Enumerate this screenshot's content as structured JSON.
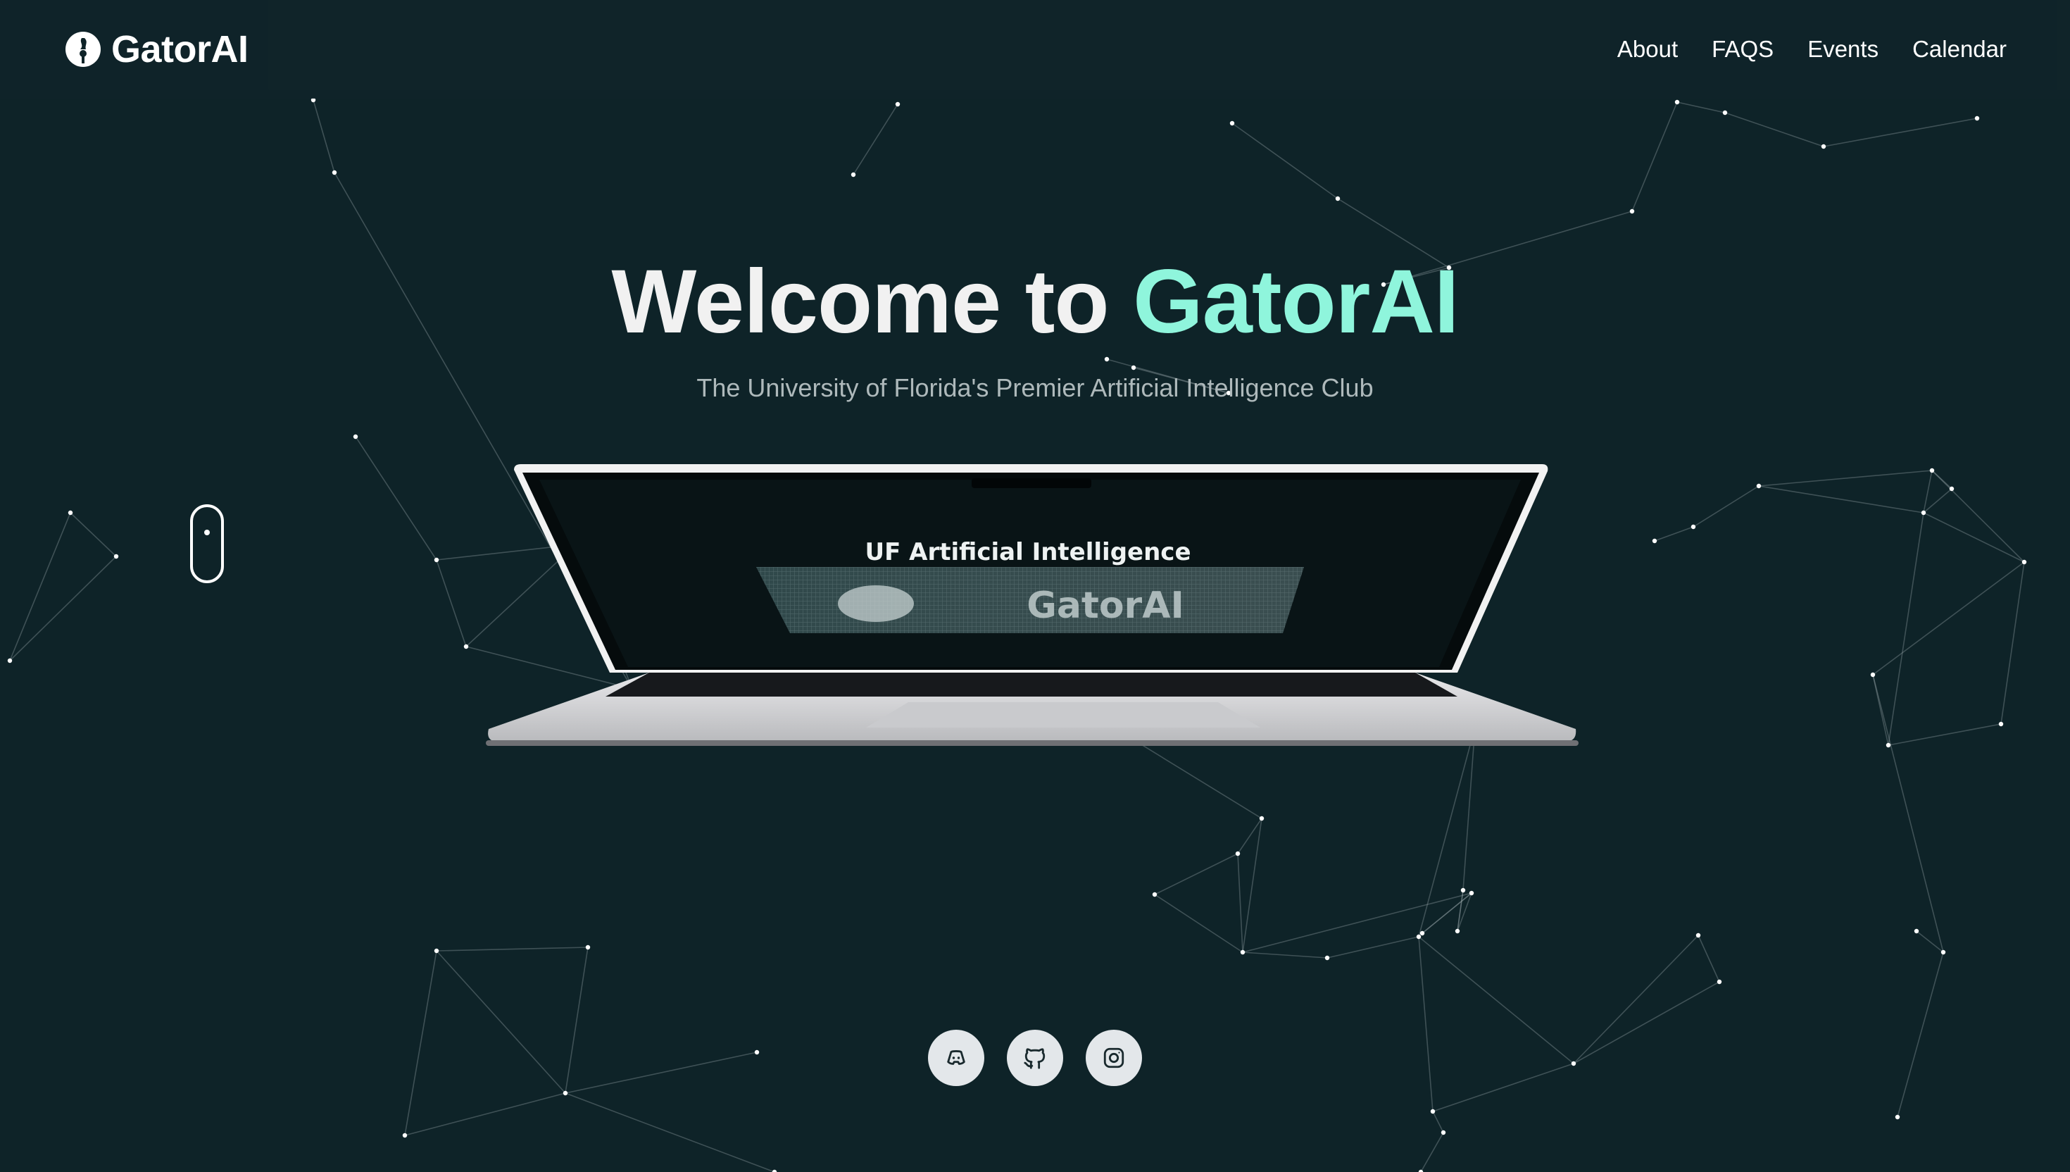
{
  "header": {
    "brand": "GatorAI",
    "nav": [
      {
        "label": "About"
      },
      {
        "label": "FAQS"
      },
      {
        "label": "Events"
      },
      {
        "label": "Calendar"
      }
    ]
  },
  "hero": {
    "title_prefix": "Welcome to ",
    "title_accent": "GatorAI",
    "subtitle": "The University of Florida's Premier Artificial Intelligence Club"
  },
  "laptop_screen": {
    "heading": "UF Artificial Intelligence",
    "banner": "GatorAI"
  },
  "socials": [
    {
      "icon": "discord-icon"
    },
    {
      "icon": "github-icon"
    },
    {
      "icon": "instagram-icon"
    }
  ],
  "colors": {
    "background": "#0e2328",
    "accent": "#8ff5dc",
    "text": "#ffffff",
    "subtitle": "#aeb9bb"
  }
}
